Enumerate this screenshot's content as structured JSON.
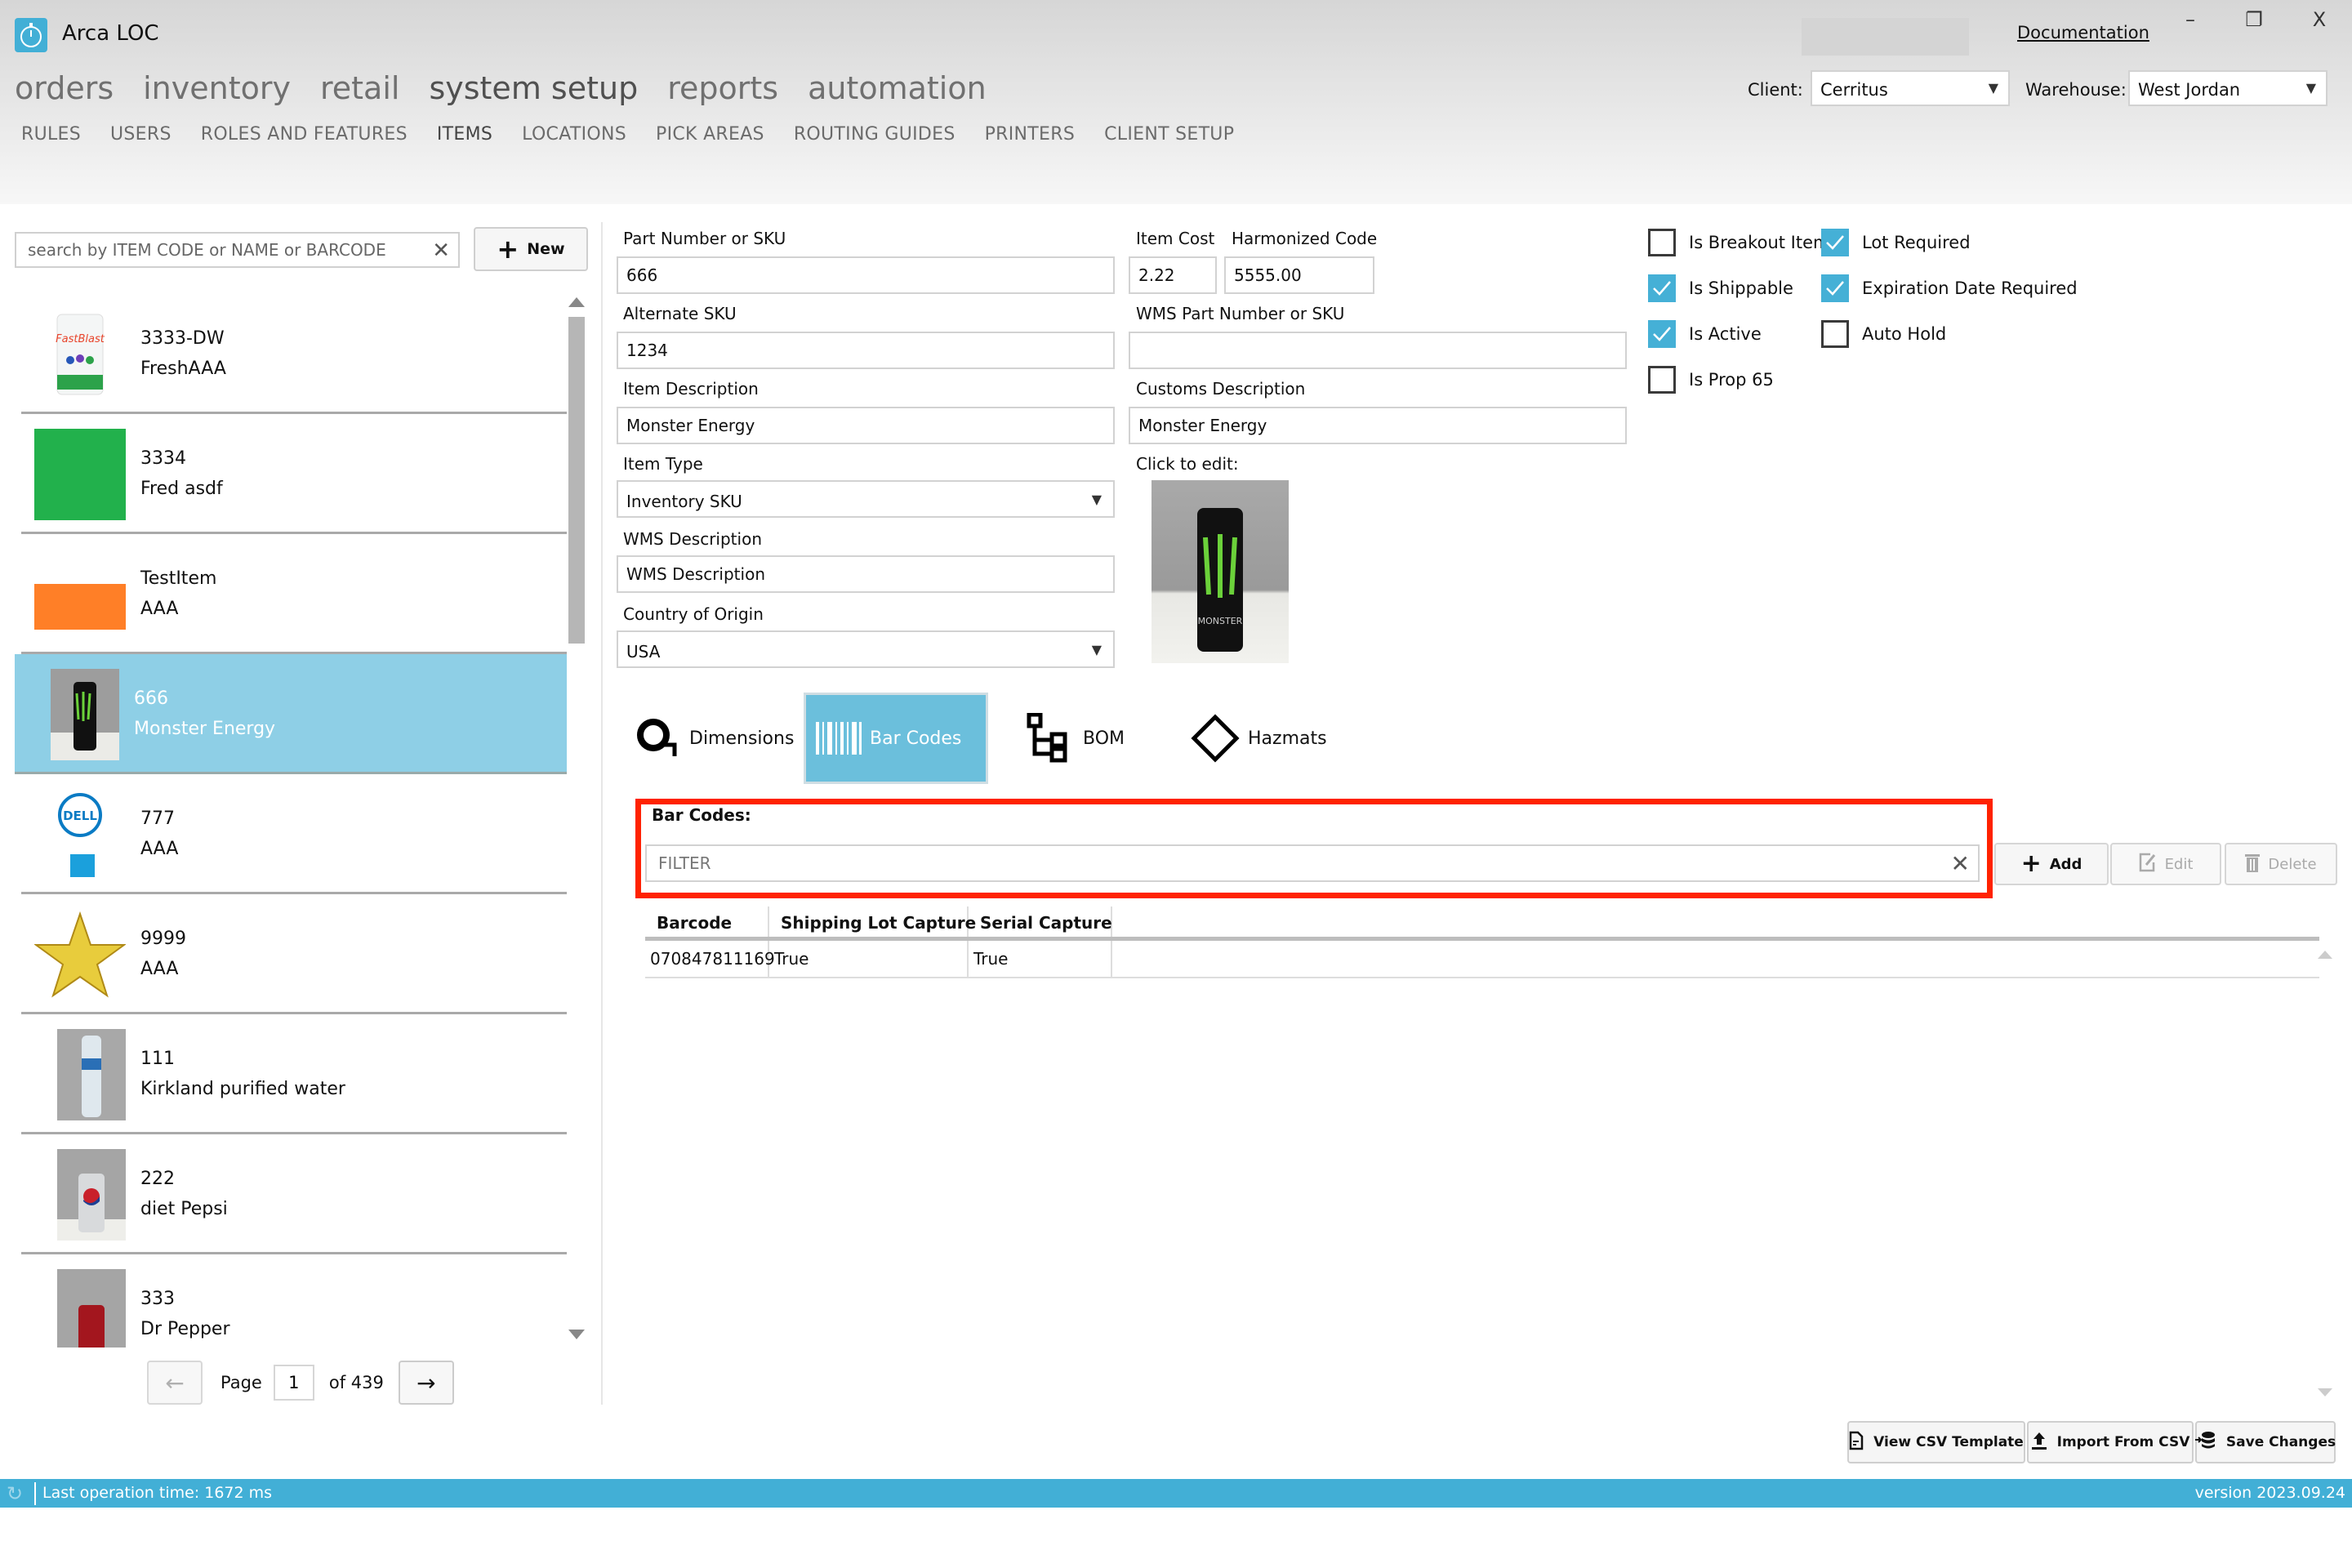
{
  "app": {
    "title": "Arca LOC",
    "documentation_link": "Documentation"
  },
  "window_controls": {
    "minimize": "–",
    "maximize": "❐",
    "close": "X"
  },
  "main_nav": [
    {
      "label": "orders"
    },
    {
      "label": "inventory"
    },
    {
      "label": "retail"
    },
    {
      "label": "system setup",
      "active": true
    },
    {
      "label": "reports"
    },
    {
      "label": "automation"
    }
  ],
  "sub_nav": [
    {
      "label": "RULES"
    },
    {
      "label": "USERS"
    },
    {
      "label": "ROLES AND FEATURES"
    },
    {
      "label": "ITEMS",
      "active": true
    },
    {
      "label": "LOCATIONS"
    },
    {
      "label": "PICK AREAS"
    },
    {
      "label": "ROUTING GUIDES"
    },
    {
      "label": "PRINTERS"
    },
    {
      "label": "CLIENT SETUP"
    }
  ],
  "selectors": {
    "client_label": "Client:",
    "client_value": "Cerritus",
    "warehouse_label": "Warehouse:",
    "warehouse_value": "West Jordan"
  },
  "search": {
    "placeholder": "search by ITEM CODE or NAME or BARCODE",
    "value": ""
  },
  "new_button": "New",
  "items": [
    {
      "code": "3333-DW",
      "name": "FreshAAA",
      "thumb": "fastblast-container"
    },
    {
      "code": "3334",
      "name": "Fred asdf",
      "thumb": "green-swatch"
    },
    {
      "code": "TestItem",
      "name": "AAA",
      "thumb": "orange-swatch"
    },
    {
      "code": "666",
      "name": "Monster Energy",
      "thumb": "monster-can",
      "selected": true
    },
    {
      "code": "777",
      "name": "AAA",
      "thumb": "dell-logo"
    },
    {
      "code": "9999",
      "name": "AAA",
      "thumb": "gold-star"
    },
    {
      "code": "111",
      "name": "Kirkland purified water",
      "thumb": "water-bottle"
    },
    {
      "code": "222",
      "name": "diet Pepsi",
      "thumb": "pepsi-can"
    },
    {
      "code": "333",
      "name": "Dr Pepper",
      "thumb": "drpepper-can"
    }
  ],
  "pager": {
    "label": "Page",
    "current": "1",
    "of_label": "of",
    "total": "439"
  },
  "form": {
    "part_number_label": "Part Number or SKU",
    "part_number": "666",
    "item_cost_label": "Item Cost",
    "item_cost": "2.22",
    "harmonized_code_label": "Harmonized Code",
    "harmonized_code": "5555.00",
    "alternate_sku_label": "Alternate SKU",
    "alternate_sku": "1234",
    "wms_part_label": "WMS Part Number or SKU",
    "wms_part": "",
    "item_description_label": "Item Description",
    "item_description": "Monster Energy",
    "customs_description_label": "Customs Description",
    "customs_description": "Monster Energy",
    "item_type_label": "Item Type",
    "item_type": "Inventory SKU",
    "click_to_edit_label": "Click to edit:",
    "wms_description_label": "WMS Description",
    "wms_description": "WMS Description",
    "country_label": "Country of Origin",
    "country": "USA"
  },
  "checkboxes": [
    {
      "label": "Is Breakout Item",
      "checked": false
    },
    {
      "label": "Lot Required",
      "checked": true
    },
    {
      "label": "Is Shippable",
      "checked": true
    },
    {
      "label": "Expiration Date Required",
      "checked": true
    },
    {
      "label": "Is Active",
      "checked": true
    },
    {
      "label": "Auto Hold",
      "checked": false
    },
    {
      "label": "Is Prop 65",
      "checked": false
    }
  ],
  "tabs": [
    {
      "label": "Dimensions"
    },
    {
      "label": "Bar Codes",
      "active": true
    },
    {
      "label": "BOM"
    },
    {
      "label": "Hazmats"
    }
  ],
  "barcodes": {
    "title": "Bar Codes:",
    "filter_placeholder": "FILTER",
    "add": "Add",
    "edit": "Edit",
    "delete": "Delete",
    "columns": [
      "Barcode",
      "Shipping Lot Capture",
      "Serial Capture"
    ],
    "rows": [
      [
        "070847811169",
        "True",
        "True"
      ]
    ]
  },
  "footer_buttons": {
    "view_csv": "View CSV Template",
    "import_csv": "Import From CSV",
    "save": "Save Changes"
  },
  "status": {
    "text": "Last operation time:  1672 ms",
    "version": "version 2023.09.24"
  },
  "colors": {
    "accent": "#42afd6",
    "selected_row": "#8ecfe6",
    "highlight": "#ff2200"
  }
}
